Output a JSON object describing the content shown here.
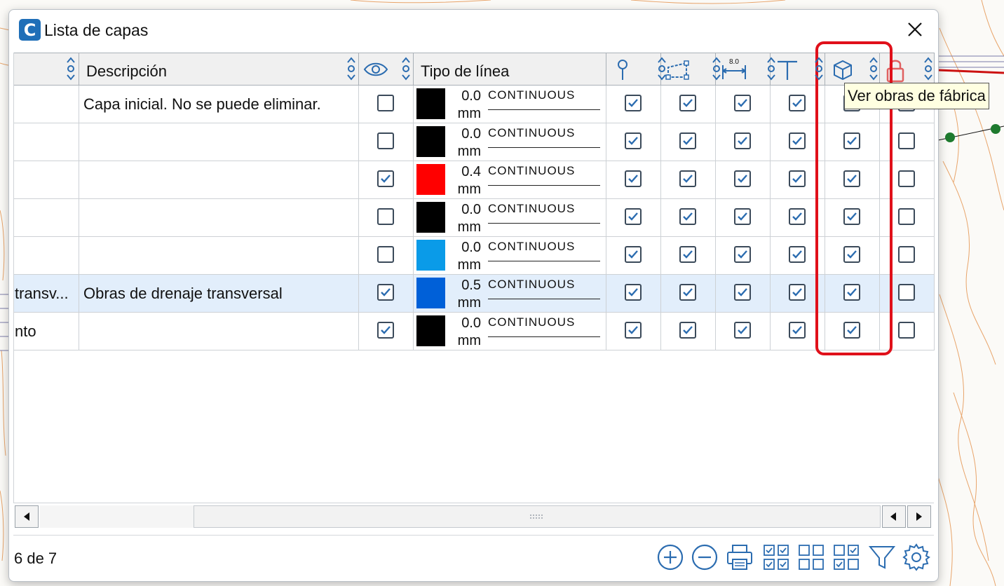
{
  "window": {
    "title": "Lista de capas",
    "app_icon_letter": "C"
  },
  "columns": {
    "name": "",
    "description": "Descripción",
    "visible": "eye-icon",
    "line_type": "Tipo de línea",
    "col_point": "pin-icon",
    "col_polyline": "polyline-icon",
    "col_dimension": "dimension-icon",
    "dimension_label": "8.0",
    "col_text": "text-icon",
    "col_structures": "cube-icon",
    "col_lock": "lock-icon"
  },
  "rows": [
    {
      "name": "",
      "description": "Capa inicial. No se puede eliminar.",
      "visible": false,
      "color": "#000000",
      "width": "0.0",
      "unit": "mm",
      "linetype": "CONTINUOUS",
      "point": true,
      "polyline": true,
      "dimension": true,
      "text": true,
      "structures": true,
      "lock": false,
      "selected": false
    },
    {
      "name": "",
      "description": "",
      "visible": false,
      "color": "#000000",
      "width": "0.0",
      "unit": "mm",
      "linetype": "CONTINUOUS",
      "point": true,
      "polyline": true,
      "dimension": true,
      "text": true,
      "structures": true,
      "lock": false,
      "selected": false
    },
    {
      "name": "",
      "description": "",
      "visible": true,
      "color": "#ff0000",
      "width": "0.4",
      "unit": "mm",
      "linetype": "CONTINUOUS",
      "point": true,
      "polyline": true,
      "dimension": true,
      "text": true,
      "structures": true,
      "lock": false,
      "selected": false
    },
    {
      "name": "",
      "description": "",
      "visible": false,
      "color": "#000000",
      "width": "0.0",
      "unit": "mm",
      "linetype": "CONTINUOUS",
      "point": true,
      "polyline": true,
      "dimension": true,
      "text": true,
      "structures": true,
      "lock": false,
      "selected": false
    },
    {
      "name": "",
      "description": "",
      "visible": false,
      "color": "#0a9be8",
      "width": "0.0",
      "unit": "mm",
      "linetype": "CONTINUOUS",
      "point": true,
      "polyline": true,
      "dimension": true,
      "text": true,
      "structures": true,
      "lock": false,
      "selected": false
    },
    {
      "name": "transv...",
      "description": "Obras de drenaje transversal",
      "visible": true,
      "color": "#0060d8",
      "width": "0.5",
      "unit": "mm",
      "linetype": "CONTINUOUS",
      "point": true,
      "polyline": true,
      "dimension": true,
      "text": true,
      "structures": true,
      "lock": false,
      "selected": true
    },
    {
      "name": "nto",
      "description": "",
      "visible": true,
      "color": "#000000",
      "width": "0.0",
      "unit": "mm",
      "linetype": "CONTINUOUS",
      "point": true,
      "polyline": true,
      "dimension": true,
      "text": true,
      "structures": true,
      "lock": false,
      "selected": false
    }
  ],
  "tooltip": "Ver obras de fábrica",
  "status": "6 de 7",
  "toolbar": [
    "add-layer-icon",
    "remove-layer-icon",
    "print-icon",
    "check-all-icon",
    "uncheck-all-icon",
    "toggle-check-icon",
    "filter-icon",
    "settings-icon"
  ],
  "colors": {
    "accent": "#1f6fb8",
    "highlight": "#e0101a",
    "selected_row": "#e2eefb",
    "check": "#2b6cb0"
  }
}
